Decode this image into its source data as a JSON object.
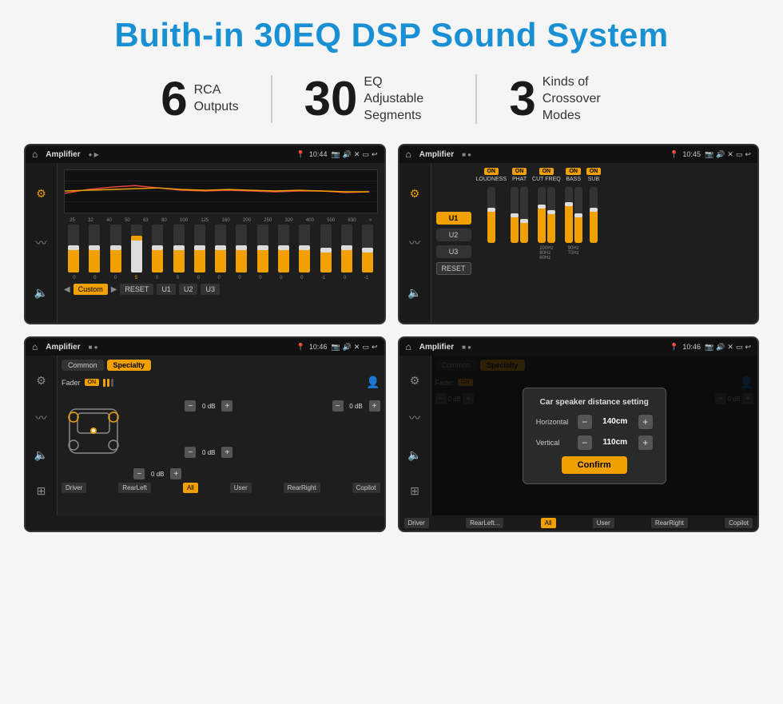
{
  "header": {
    "title": "Buith-in 30EQ DSP Sound System"
  },
  "stats": [
    {
      "number": "6",
      "label": "RCA\nOutputs"
    },
    {
      "number": "30",
      "label": "EQ Adjustable\nSegments"
    },
    {
      "number": "3",
      "label": "Kinds of\nCrossover Modes"
    }
  ],
  "screens": [
    {
      "id": "eq-screen",
      "statusBar": {
        "appName": "Amplifier",
        "time": "10:44"
      },
      "type": "equalizer",
      "freqs": [
        "25",
        "32",
        "40",
        "50",
        "63",
        "80",
        "100",
        "125",
        "160",
        "200",
        "250",
        "320",
        "400",
        "500",
        "630"
      ],
      "values": [
        0,
        0,
        0,
        5,
        0,
        0,
        0,
        0,
        0,
        0,
        0,
        0,
        -1,
        0,
        -1
      ],
      "preset": "Custom",
      "buttons": [
        "Custom",
        "RESET",
        "U1",
        "U2",
        "U3"
      ]
    },
    {
      "id": "crossover-screen",
      "statusBar": {
        "appName": "Amplifier",
        "time": "10:45"
      },
      "type": "crossover",
      "units": [
        "U1",
        "U2",
        "U3"
      ],
      "controls": [
        {
          "id": "loudness",
          "label": "LOUDNESS",
          "on": true
        },
        {
          "id": "phat",
          "label": "PHAT",
          "on": true
        },
        {
          "id": "cutfreq",
          "label": "CUT FREQ",
          "on": true
        },
        {
          "id": "bass",
          "label": "BASS",
          "on": true
        },
        {
          "id": "sub",
          "label": "SUB",
          "on": true
        }
      ],
      "resetLabel": "RESET"
    },
    {
      "id": "fader-screen",
      "statusBar": {
        "appName": "Amplifier",
        "time": "10:46"
      },
      "type": "fader",
      "tabs": [
        "Common",
        "Specialty"
      ],
      "faderLabel": "Fader",
      "onLabel": "ON",
      "speakers": {
        "frontLeft": "0 dB",
        "frontRight": "0 dB",
        "rearLeft": "0 dB",
        "rearRight": "0 dB"
      },
      "bottomLabels": [
        "Driver",
        "RearLeft",
        "All",
        "User",
        "RearRight",
        "Copilot"
      ]
    },
    {
      "id": "distance-screen",
      "statusBar": {
        "appName": "Amplifier",
        "time": "10:46"
      },
      "type": "distance",
      "tabs": [
        "Common",
        "Specialty"
      ],
      "dialog": {
        "title": "Car speaker distance setting",
        "horizontal": {
          "label": "Horizontal",
          "value": "140cm"
        },
        "vertical": {
          "label": "Vertical",
          "value": "110cm"
        },
        "confirmLabel": "Confirm"
      },
      "speakers": {
        "frontLeft": "0 dB",
        "frontRight": "0 dB"
      },
      "bottomLabels": [
        "Driver",
        "RearLeft",
        "All",
        "User",
        "RearRight",
        "Copilot"
      ]
    }
  ],
  "colors": {
    "accent": "#f0a000",
    "titleBlue": "#1a90d4",
    "dark": "#1a1a1a",
    "medium": "#333",
    "light": "#ccc"
  }
}
